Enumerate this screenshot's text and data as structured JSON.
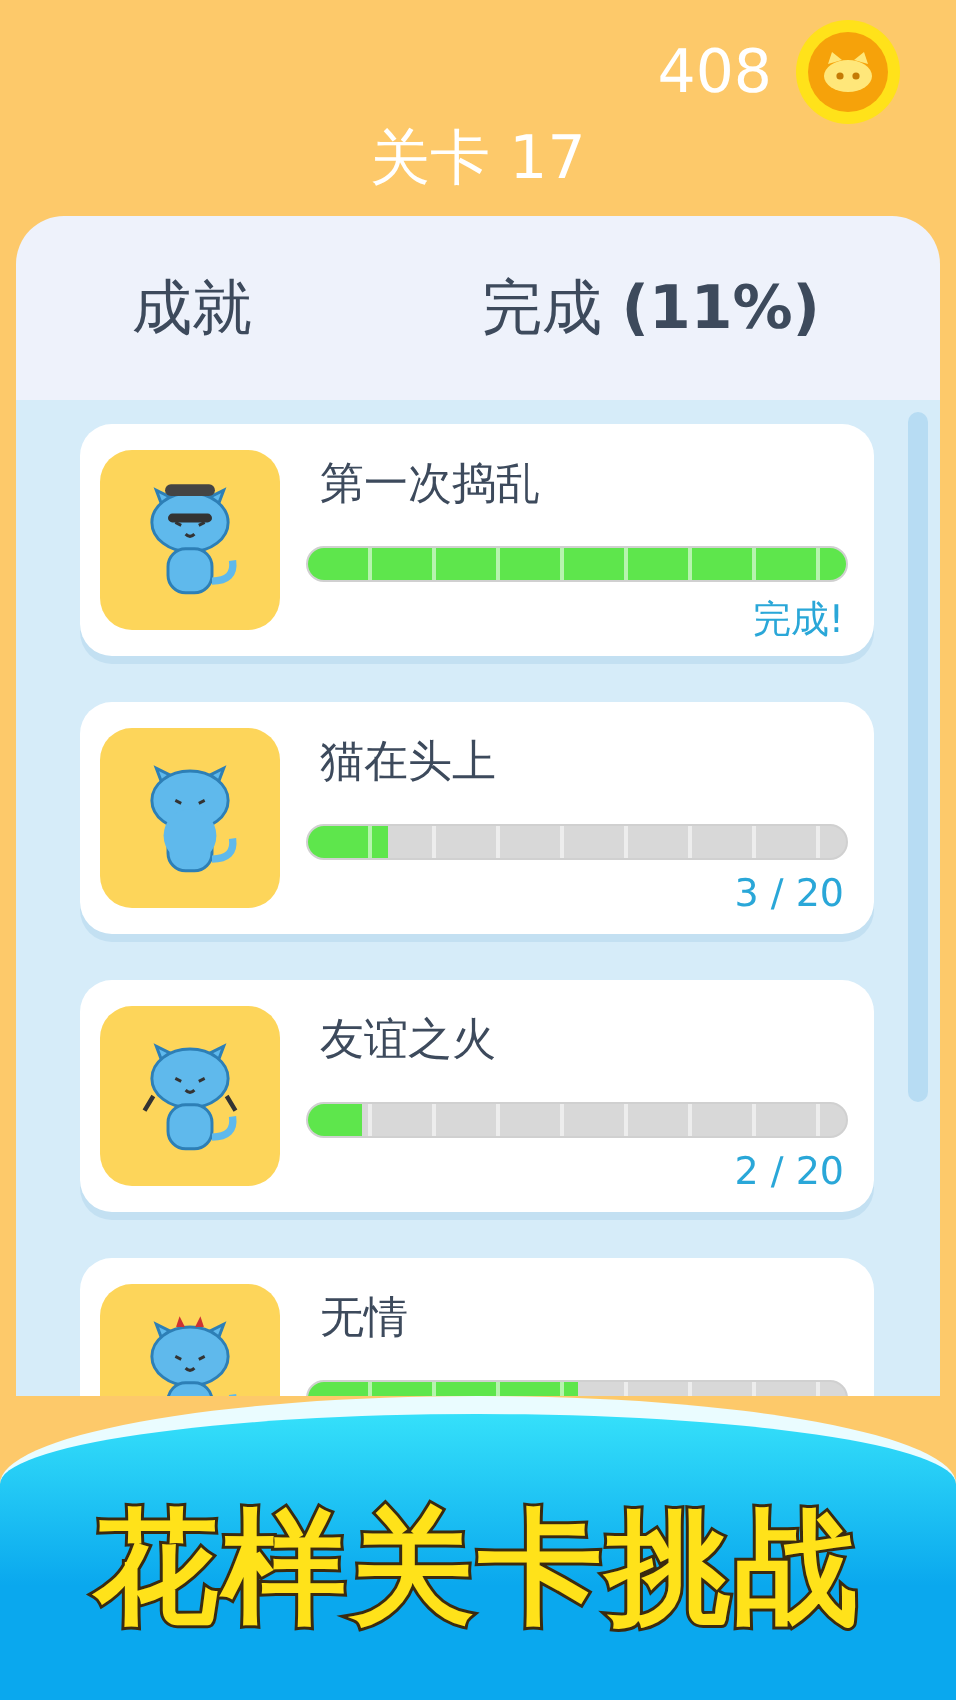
{
  "coins": "408",
  "level_title": "关卡 17",
  "panel": {
    "title": "成就",
    "completion": "完成 **(11%)**"
  },
  "achievements": [
    {
      "title": "第一次捣乱",
      "level": 1,
      "progress": "完成!"
    },
    {
      "title": "猫在头上",
      "level": 0.15,
      "progress": "3 / 20"
    },
    {
      "title": "友谊之火",
      "level": 0.1,
      "progress": "2 / 20"
    },
    {
      "title": "无情",
      "level": 0.5
    }
  ],
  "banner": "花样关卡挑战"
}
